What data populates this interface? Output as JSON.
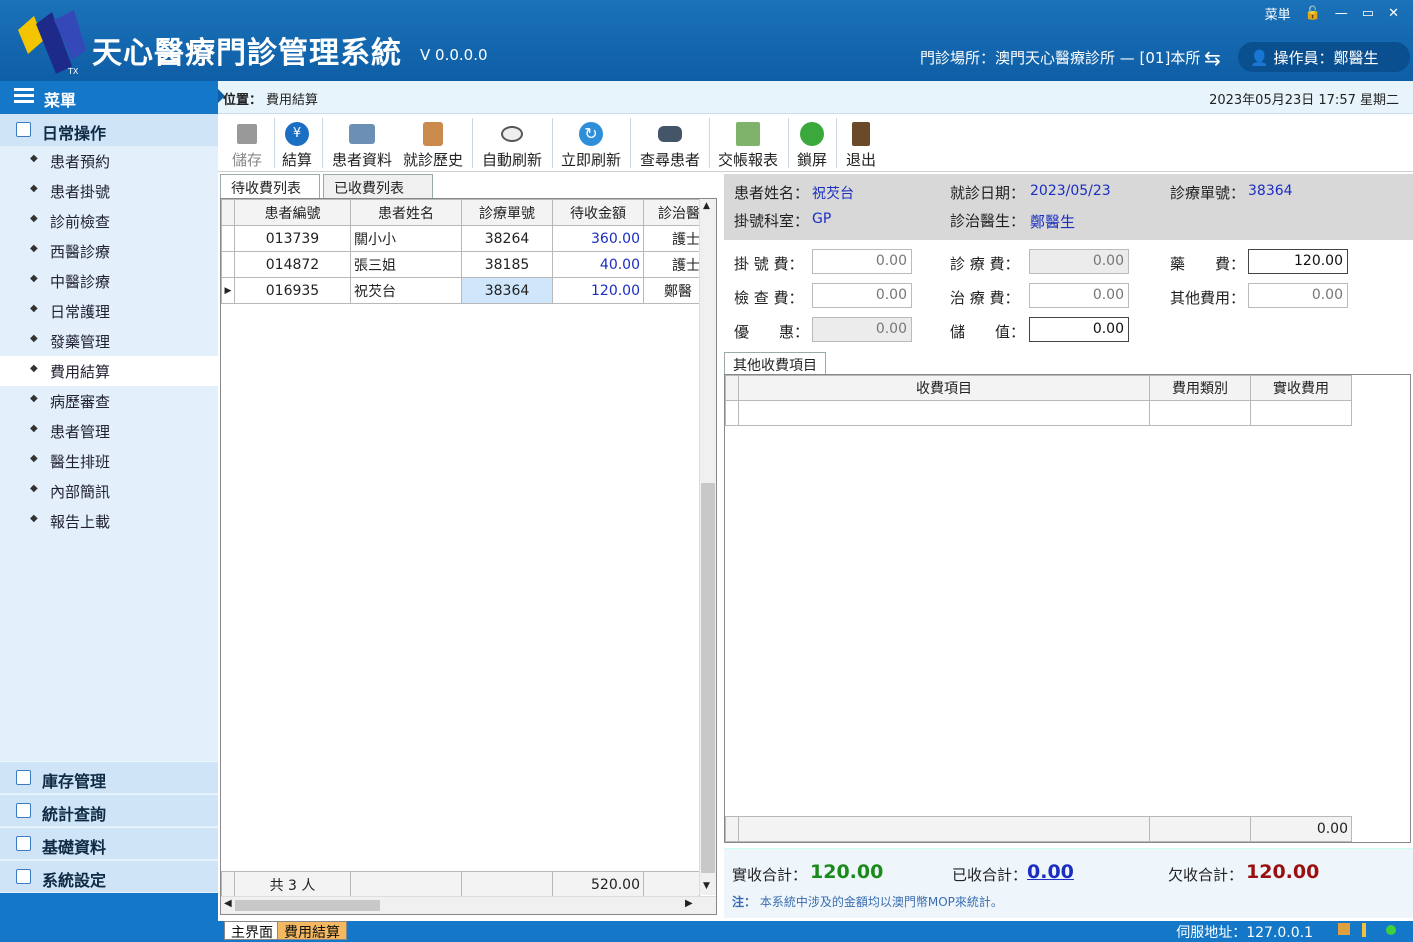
{
  "app": {
    "title": "天心醫療門診管理系統",
    "version": "V 0.0.0.0",
    "menu_btn": "菜単",
    "clinic_info": "門診場所：澳門天心醫療診所 — [01]本所",
    "operator": "操作員：鄭醫生"
  },
  "sidebar": {
    "menu": "菜單",
    "section_daily": "日常操作",
    "items": [
      "患者預約",
      "患者掛號",
      "診前檢查",
      "西醫診療",
      "中醫診療",
      "日常護理",
      "發藥管理",
      "費用結算",
      "病歷審查",
      "患者管理",
      "醫生排班",
      "內部簡訊",
      "報告上載"
    ],
    "active_index": 7,
    "sections": [
      "庫存管理",
      "統計查詢",
      "基礎資料",
      "系統設定"
    ]
  },
  "breadcrumb": {
    "label": "位置：",
    "page": "費用結算",
    "datetime": "2023年05月23日 17:57 星期二"
  },
  "toolbar": {
    "save": "儲存",
    "checkout": "結算",
    "patient_info": "患者資料",
    "visit_history": "就診歷史",
    "auto_refresh": "自動刷新",
    "refresh_now": "立即刷新",
    "find_patient": "查尋患者",
    "shift_report": "交帳報表",
    "lock": "鎖屏",
    "exit": "退出"
  },
  "tabs": {
    "pending": "待收費列表",
    "collected": "已收費列表"
  },
  "pending_table": {
    "headers": [
      "患者編號",
      "患者姓名",
      "診療單號",
      "待收金額",
      "診治醫"
    ],
    "rows": [
      [
        "013739",
        "關小小",
        "38264",
        "360.00",
        "護士"
      ],
      [
        "014872",
        "張三姐",
        "38185",
        "40.00",
        "護士"
      ],
      [
        "016935",
        "祝芡台",
        "38364",
        "120.00",
        "鄭醫"
      ]
    ],
    "footer_count": "共 3 人",
    "footer_total": "520.00"
  },
  "patient": {
    "name_label": "患者姓名：",
    "name": "祝芡台",
    "date_label": "就診日期：",
    "date": "2023/05/23",
    "order_label": "診療單號：",
    "order": "38364",
    "dept_label": "掛號科室：",
    "dept": "GP",
    "doctor_label": "診治醫生：",
    "doctor": "鄭醫生"
  },
  "fees": {
    "reg_label": "掛 號 費：",
    "reg": "0.00",
    "consult_label": "診 療 費：",
    "consult": "0.00",
    "med_label": "藥　　費：",
    "med": "120.00",
    "exam_label": "檢 查 費：",
    "exam": "0.00",
    "treat_label": "治 療 費：",
    "treat": "0.00",
    "other_label": "其他費用：",
    "other": "0.00",
    "discount_label": "優　　惠：",
    "discount": "0.00",
    "stored_label": "儲　　值：",
    "stored": "0.00"
  },
  "other_items": {
    "tab": "其他收費項目",
    "headers": [
      "收費項目",
      "費用類別",
      "實收費用"
    ],
    "footer_total": "0.00"
  },
  "totals": {
    "receivable_label": "實收合計：",
    "receivable": "120.00",
    "received_label": "已收合計：",
    "received": "0.00",
    "owed_label": "欠收合計：",
    "owed": "120.00",
    "note_prefix": "注：",
    "note": "本系統中涉及的金額均以澳門幣MOP來統計。"
  },
  "status": {
    "tab_main": "主界面",
    "tab_current": "費用結算",
    "server": "伺服地址：127.0.0.1"
  },
  "colors": {
    "header": "#0e5ea6",
    "accent_green": "#1a8a1a",
    "accent_red": "#9a1010",
    "link_blue": "#1a2ec0"
  }
}
